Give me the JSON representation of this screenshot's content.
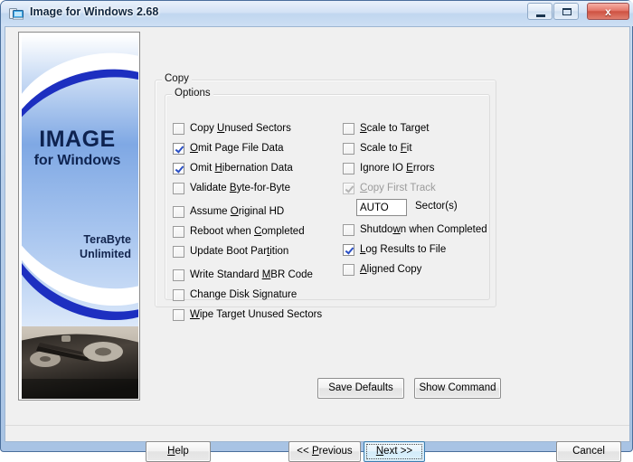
{
  "window": {
    "title": "Image for Windows 2.68",
    "icon": "app-disk-icon",
    "controls": {
      "minimize": "minimize-icon",
      "maximize": "maximize-icon",
      "close_label": "x"
    }
  },
  "banner": {
    "title": "IMAGE",
    "subtitle": "for Windows",
    "company_line1": "TeraByte",
    "company_line2": "Unlimited",
    "image": "hard-drive-photo"
  },
  "groups": {
    "copy_label": "Copy",
    "options_label": "Options"
  },
  "options_left": [
    {
      "label": "Copy Unused Sectors",
      "pre": "Copy ",
      "accel": "U",
      "post": "nused Sectors",
      "checked": false,
      "disabled": false
    },
    {
      "label": "Omit Page File Data",
      "pre": "",
      "accel": "O",
      "post": "mit Page File Data",
      "checked": true,
      "disabled": false
    },
    {
      "label": "Omit Hibernation Data",
      "pre": "Omit ",
      "accel": "H",
      "post": "ibernation Data",
      "checked": true,
      "disabled": false
    },
    {
      "label": "Validate Byte-for-Byte",
      "pre": "Validate ",
      "accel": "B",
      "post": "yte-for-Byte",
      "checked": false,
      "disabled": false
    },
    {
      "label": "Assume Original HD",
      "pre": "Assume ",
      "accel": "O",
      "post": "riginal HD",
      "checked": false,
      "disabled": false
    },
    {
      "label": "Reboot when Completed",
      "pre": "Reboot when ",
      "accel": "C",
      "post": "ompleted",
      "checked": false,
      "disabled": false
    },
    {
      "label": "Update Boot Partition",
      "pre": "Update Boot Par",
      "accel": "t",
      "post": "ition",
      "checked": false,
      "disabled": false
    },
    {
      "label": "Write Standard MBR Code",
      "pre": "Write Standard ",
      "accel": "M",
      "post": "BR Code",
      "checked": false,
      "disabled": false
    },
    {
      "label": "Change Disk Signature",
      "pre": "Change Disk Si",
      "accel": "g",
      "post": "nature",
      "checked": false,
      "disabled": false
    },
    {
      "label": "Wipe Target Unused Sectors",
      "pre": "",
      "accel": "W",
      "post": "ipe Target Unused Sectors",
      "checked": false,
      "disabled": false
    }
  ],
  "options_right": [
    {
      "label": "Scale to Target",
      "pre": "",
      "accel": "S",
      "post": "cale to Target",
      "checked": false,
      "disabled": false
    },
    {
      "label": "Scale to Fit",
      "pre": "Scale to ",
      "accel": "F",
      "post": "it",
      "checked": false,
      "disabled": false
    },
    {
      "label": "Ignore IO Errors",
      "pre": "Ignore IO ",
      "accel": "E",
      "post": "rrors",
      "checked": false,
      "disabled": false
    },
    {
      "label": "Copy First Track",
      "pre": "",
      "accel": "C",
      "post": "opy First Track",
      "checked": true,
      "disabled": true
    },
    {
      "label": "Shutdown when Completed",
      "pre": "Shutdo",
      "accel": "w",
      "post": "n when Completed",
      "checked": false,
      "disabled": false
    },
    {
      "label": "Log Results to File",
      "pre": "",
      "accel": "L",
      "post": "og Results to File",
      "checked": true,
      "disabled": false
    },
    {
      "label": "Aligned Copy",
      "pre": "",
      "accel": "A",
      "post": "ligned Copy",
      "checked": false,
      "disabled": false
    }
  ],
  "sector_field": {
    "value": "AUTO",
    "placeholder": "AUTO",
    "label": "Sector(s)"
  },
  "buttons": {
    "save_defaults": "Save Defaults",
    "show_command": "Show Command",
    "help": {
      "pre": "",
      "accel": "H",
      "post": "elp"
    },
    "previous": {
      "pre": "<< ",
      "accel": "P",
      "post": "revious"
    },
    "next": {
      "pre": "",
      "accel": "N",
      "post": "ext >>"
    },
    "cancel": "Cancel"
  },
  "colors": {
    "accent_blue": "#2a4fc4",
    "banner_blue": "#7fa8e4",
    "focus_border": "#3c7fb1",
    "close_red": "#cf5242",
    "dialog_bg": "#f0f0f0"
  }
}
